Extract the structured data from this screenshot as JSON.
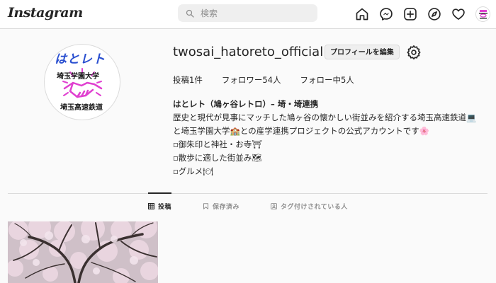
{
  "header": {
    "logo_text": "Instagram",
    "search_placeholder": "検索",
    "nav_icons": [
      "home-icon",
      "messenger-icon",
      "new-post-icon",
      "explore-icon",
      "activity-heart-icon",
      "profile-avatar"
    ]
  },
  "profile": {
    "username": "twosai_hatoreto_official",
    "edit_button": "プロフィールを編集",
    "avatar_texts": [
      "はとレト",
      "埼玉学園大学",
      "埼玉高速鉄道"
    ],
    "stats": {
      "posts_label": "投稿",
      "posts_count": "1件",
      "followers_label": "フォロワー",
      "followers_count": "54人",
      "following_label": "フォロー中",
      "following_count": "5人"
    },
    "bio": {
      "name": "はとレト（鳩ヶ谷レトロ）– 埼・埼連携",
      "lines": [
        "歴史と現代が見事にマッチした鳩ヶ谷の懐かしい街並みを紹介する埼玉高速鉄道💻",
        "と埼玉学園大学🏫との産学連携プロジェクトの公式アカウントです🌸",
        "▫御朱印と神社・お寺⛩",
        "▫散歩に適した街並み🗺",
        "▫グルメ🍽"
      ]
    }
  },
  "tabs": [
    {
      "label": "投稿",
      "icon": "grid-icon",
      "active": true
    },
    {
      "label": "保存済み",
      "icon": "bookmark-icon",
      "active": false
    },
    {
      "label": "タグ付けされている人",
      "icon": "tagged-icon",
      "active": false
    }
  ],
  "colors": {
    "accent": "#262626",
    "logo_magenta": "#e040d0",
    "logo_blue": "#2a4fd0",
    "background": "#fafafa"
  }
}
